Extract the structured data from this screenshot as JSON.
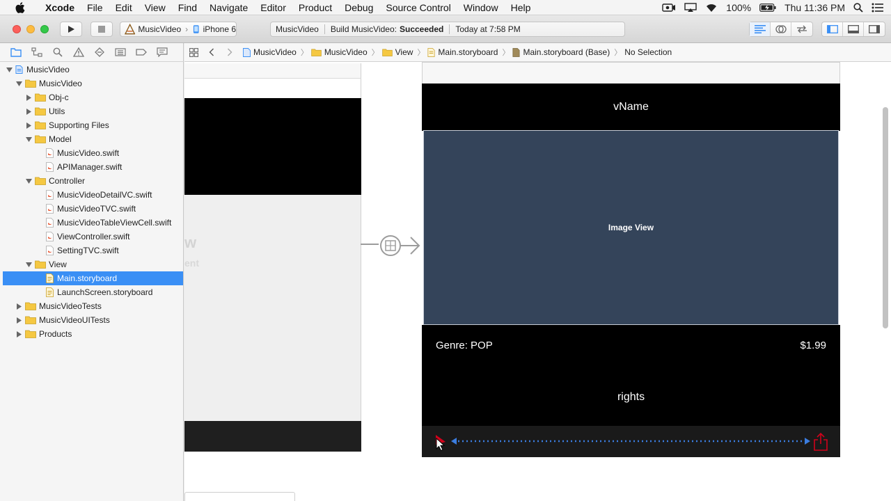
{
  "menubar": {
    "app": "Xcode",
    "items": [
      "File",
      "Edit",
      "View",
      "Find",
      "Navigate",
      "Editor",
      "Product",
      "Debug",
      "Source Control",
      "Window",
      "Help"
    ],
    "battery": "100%",
    "clock": "Thu 11:36 PM"
  },
  "toolbar": {
    "scheme_target": "MusicVideo",
    "scheme_device": "iPhone 6",
    "activity_project": "MusicVideo",
    "activity_prefix": "Build MusicVideo:",
    "activity_status": "Succeeded",
    "activity_time": "Today at 7:58 PM"
  },
  "navigator": {
    "rows": [
      {
        "label": "MusicVideo",
        "type": "project",
        "disclosure": "open"
      },
      {
        "label": "MusicVideo",
        "type": "folder",
        "disclosure": "open"
      },
      {
        "label": "Obj-c",
        "type": "folder",
        "disclosure": "closed"
      },
      {
        "label": "Utils",
        "type": "folder",
        "disclosure": "closed"
      },
      {
        "label": "Supporting Files",
        "type": "folder",
        "disclosure": "closed"
      },
      {
        "label": "Model",
        "type": "folder",
        "disclosure": "open"
      },
      {
        "label": "MusicVideo.swift",
        "type": "swift"
      },
      {
        "label": "APIManager.swift",
        "type": "swift"
      },
      {
        "label": "Controller",
        "type": "folder",
        "disclosure": "open"
      },
      {
        "label": "MusicVideoDetailVC.swift",
        "type": "swift"
      },
      {
        "label": "MusicVideoTVC.swift",
        "type": "swift"
      },
      {
        "label": "MusicVideoTableViewCell.swift",
        "type": "swift"
      },
      {
        "label": "ViewController.swift",
        "type": "swift"
      },
      {
        "label": "SettingTVC.swift",
        "type": "swift"
      },
      {
        "label": "View",
        "type": "folder",
        "disclosure": "open"
      },
      {
        "label": "Main.storyboard",
        "type": "storyboard",
        "selected": true
      },
      {
        "label": "LaunchScreen.storyboard",
        "type": "storyboard"
      },
      {
        "label": "MusicVideoTests",
        "type": "folder",
        "disclosure": "closed"
      },
      {
        "label": "MusicVideoUITests",
        "type": "folder",
        "disclosure": "closed"
      },
      {
        "label": "Products",
        "type": "folder",
        "disclosure": "closed"
      }
    ]
  },
  "jumpbar": {
    "crumbs": [
      "MusicVideo",
      "MusicVideo",
      "View",
      "Main.storyboard",
      "Main.storyboard (Base)",
      "No Selection"
    ]
  },
  "canvas": {
    "left_fragment_title": "w",
    "left_fragment_sub": "ent",
    "detail": {
      "title": "vName",
      "image_label": "Image View",
      "genre": "Genre: POP",
      "price": "$1.99",
      "rights": "rights"
    }
  },
  "colors": {
    "selection": "#3a8ff5",
    "image_view": "#34445a",
    "constraint_line": "#3b7de0",
    "alert_red": "#d0021b",
    "folder": "#f5c842"
  }
}
